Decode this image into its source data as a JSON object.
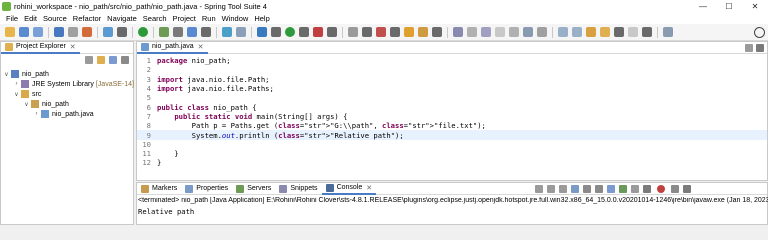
{
  "window": {
    "title": "rohini_workspace - nio_path/src/nio_path/nio_path.java - Spring Tool Suite 4",
    "minimize": "—",
    "maximize": "☐",
    "close": "✕"
  },
  "menu": [
    "File",
    "Edit",
    "Source",
    "Refactor",
    "Navigate",
    "Search",
    "Project",
    "Run",
    "Window",
    "Help"
  ],
  "explorer": {
    "tab_label": "Project Explorer",
    "close": "✕",
    "tree": [
      {
        "twisty": "∨",
        "label": "nio_path",
        "suffix": ""
      },
      {
        "twisty": "›",
        "label": "JRE System Library",
        "suffix": "[JavaSE-14]"
      },
      {
        "twisty": "∨",
        "label": "src",
        "suffix": ""
      },
      {
        "twisty": "∨",
        "label": "nio_path",
        "suffix": ""
      },
      {
        "twisty": "›",
        "label": "nio_path.java",
        "suffix": ""
      }
    ]
  },
  "editor": {
    "tab_label": "nio_path.java",
    "close": "✕",
    "lines": [
      {
        "n": "1",
        "text": "package nio_path;"
      },
      {
        "n": "2",
        "text": ""
      },
      {
        "n": "3",
        "text": "import java.nio.file.Path;"
      },
      {
        "n": "4",
        "text": "import java.nio.file.Paths;"
      },
      {
        "n": "5",
        "text": ""
      },
      {
        "n": "6",
        "text": "public class nio_path {"
      },
      {
        "n": "7",
        "text": "    public static void main(String[] args) {"
      },
      {
        "n": "8",
        "text": "        Path p = Paths.get (\"G:\\\\path\", \"file.txt\");"
      },
      {
        "n": "9",
        "text": "        System.out.println (\"Relative path\");"
      },
      {
        "n": "10",
        "text": ""
      },
      {
        "n": "11",
        "text": "    }"
      },
      {
        "n": "12",
        "text": "}"
      }
    ],
    "current_line": "9"
  },
  "bottom": {
    "tabs": [
      "Markers",
      "Properties",
      "Servers",
      "Snippets",
      "Console"
    ],
    "active_tab": "Console",
    "console_header": "<terminated> nio_path [Java Application] E:\\Rohini\\Rohini Clover\\sts-4.8.1.RELEASE\\plugins\\org.eclipse.justj.openjdk.hotspot.jre.full.win32.x86_64_15.0.0.v20201014-1246\\jre\\bin\\javaw.exe  (Jan 18, 2023, 11:50:43 AM",
    "console_output": "Relative path"
  },
  "colors": {
    "keyword": "#7f0055",
    "string": "#2a00ff",
    "field": "#0000c0",
    "current_line": "#e8f2fe",
    "active_tab_underline": "#4a7cc5"
  }
}
